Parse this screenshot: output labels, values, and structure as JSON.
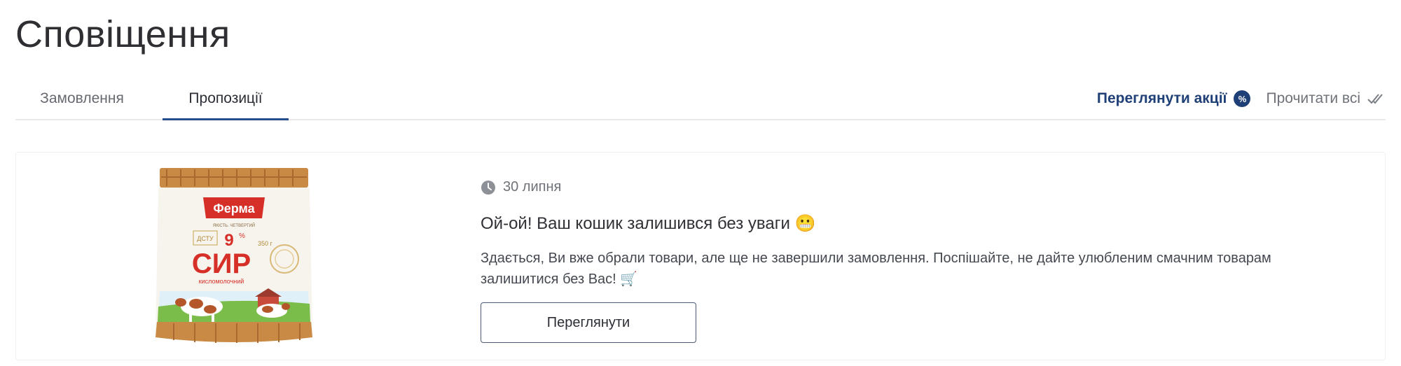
{
  "page": {
    "title": "Сповіщення"
  },
  "tabs": [
    {
      "label": "Замовлення",
      "active": false
    },
    {
      "label": "Пропозиції",
      "active": true
    }
  ],
  "actions": {
    "view_promotions": {
      "label": "Переглянути акції",
      "icon": "percent-badge-icon",
      "icon_text": "%"
    },
    "read_all": {
      "label": "Прочитати всі",
      "icon": "double-check-icon"
    }
  },
  "notification": {
    "date": "30 липня",
    "title": "Ой-ой! Ваш кошик залишився без уваги 😬",
    "body": "Здається, Ви вже обрали товари, але ще не завершили замовлення. Поспішайте, не дайте улюбленим смачним товарам залишитися без Вас! 🛒",
    "button_label": "Переглянути",
    "product": {
      "brand": "Ферма",
      "brand_sub": "ЯКІСТЬ. ЧЕТВЕРТИЙ",
      "fat": "9",
      "fat_unit": "%",
      "name": "СИР",
      "subtitle": "кисломолочний",
      "weight": "350 г",
      "standard": "ДСТУ"
    }
  },
  "colors": {
    "accent": "#1f3f77",
    "tab_underline": "#264d8c",
    "divider": "#e8e9ec",
    "brand_red": "#d62f28"
  }
}
